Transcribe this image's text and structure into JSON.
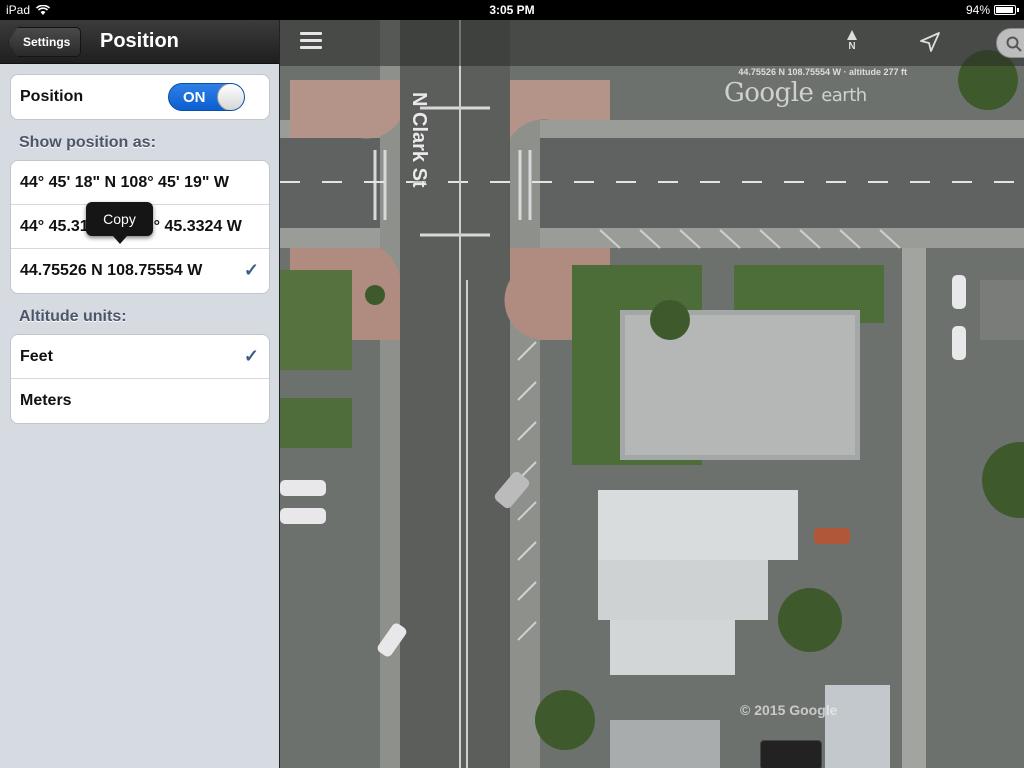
{
  "status_bar": {
    "device": "iPad",
    "time": "3:05 PM",
    "battery": "94%",
    "battery_level": 0.94
  },
  "settings_panel": {
    "back_label": "Settings",
    "title": "Position",
    "position_toggle": {
      "label": "Position",
      "state": "ON"
    },
    "show_position_header": "Show position as:",
    "position_formats": [
      {
        "label": "44° 45' 18\" N  108° 45' 19\" W",
        "selected": false
      },
      {
        "label": "44° 45.3155 N  108° 45.3324 W",
        "selected": false
      },
      {
        "label": "44.75526 N  108.75554 W",
        "selected": true
      }
    ],
    "altitude_header": "Altitude units:",
    "altitude_units": [
      {
        "label": "Feet",
        "selected": true
      },
      {
        "label": "Meters",
        "selected": false
      }
    ],
    "check_glyph": "✓",
    "tooltip": "Copy"
  },
  "map": {
    "coordinate_readout": "44.75526 N  108.75554 W · altitude 277 ft",
    "logo": "Google",
    "logo_suffix": "earth",
    "street_label": "N Clark St",
    "copyright": "© 2015 Google",
    "north_label": "N",
    "icons": [
      "menu-icon",
      "north-arrow-icon",
      "location-arrow-icon",
      "search-icon"
    ]
  }
}
